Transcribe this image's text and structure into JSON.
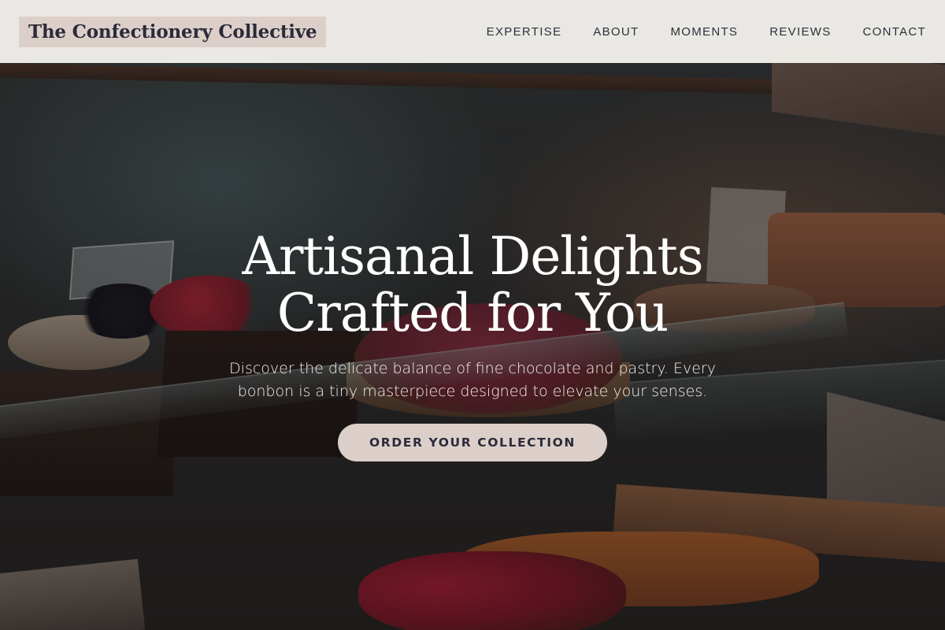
{
  "header": {
    "brand": "The Confectionery Collective",
    "nav": [
      {
        "label": "EXPERTISE"
      },
      {
        "label": "ABOUT"
      },
      {
        "label": "MOMENTS"
      },
      {
        "label": "REVIEWS"
      },
      {
        "label": "CONTACT"
      }
    ]
  },
  "hero": {
    "title_line1": "Artisanal Delights",
    "title_line2": "Crafted for You",
    "subtitle": "Discover the delicate balance of fine chocolate and pastry. Every bonbon is a tiny masterpiece designed to elevate your senses.",
    "cta_label": "ORDER YOUR COLLECTION"
  },
  "colors": {
    "header_bg": "#f3f0ec",
    "accent": "#dccfca",
    "text_dark": "#2b2b38",
    "hero_text": "#ffffff"
  }
}
